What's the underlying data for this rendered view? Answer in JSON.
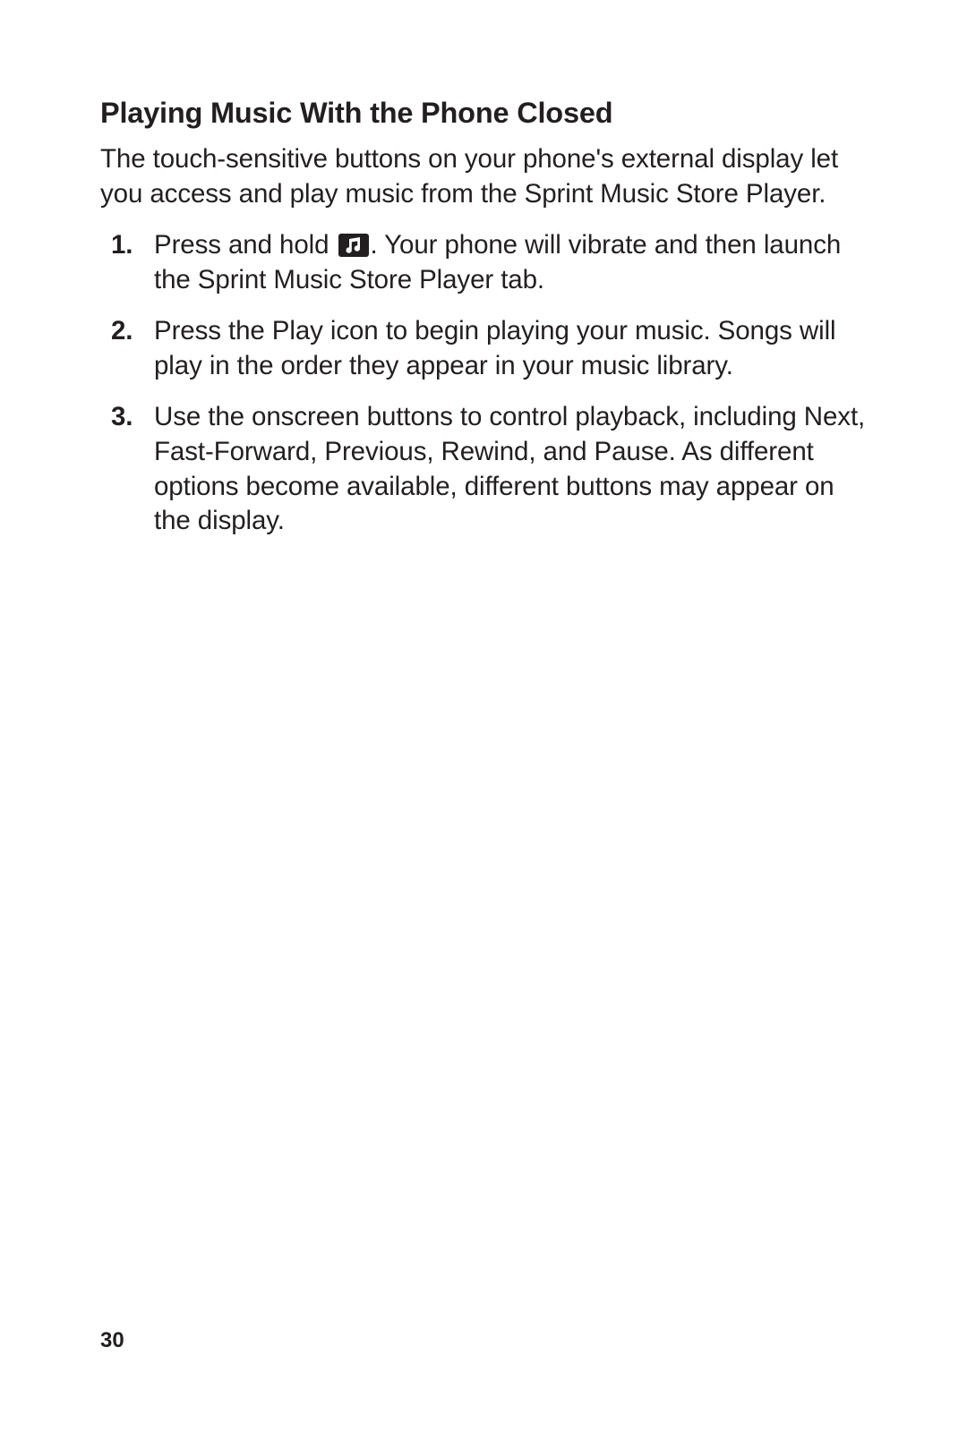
{
  "title": "Playing Music With the Phone Closed",
  "intro": "The touch-sensitive buttons on your phone's external display let you access and play music from the Sprint Music Store Player.",
  "steps": [
    {
      "num": "1.",
      "pre": "Press and hold ",
      "post": ". Your phone will vibrate and then launch the Sprint Music Store Player tab."
    },
    {
      "num": "2.",
      "text": "Press the Play icon to begin playing your music. Songs will play in the order they appear in your music library."
    },
    {
      "num": "3.",
      "text": "Use the onscreen buttons to control playback, including Next, Fast-Forward, Previous, Rewind, and Pause. As different options become available, different buttons may appear on the display."
    }
  ],
  "page_number": "30",
  "icons": {
    "music": "music-icon"
  }
}
